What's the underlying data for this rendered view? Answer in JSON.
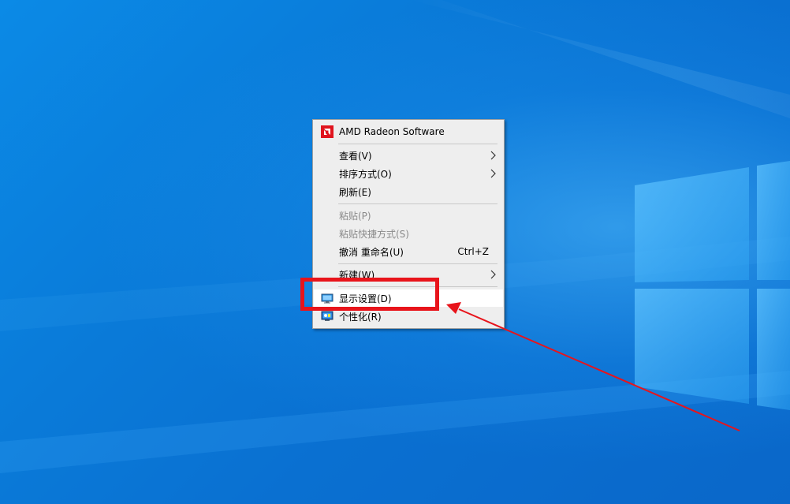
{
  "context_menu": {
    "header": {
      "label": "AMD Radeon Software",
      "icon": "amd-radeon-icon",
      "icon_color": "#e0141e"
    },
    "items": [
      {
        "label": "查看(V)",
        "has_submenu": true
      },
      {
        "label": "排序方式(O)",
        "has_submenu": true
      },
      {
        "label": "刷新(E)"
      },
      {
        "label": "粘贴(P)",
        "disabled": true
      },
      {
        "label": "粘贴快捷方式(S)",
        "disabled": true
      },
      {
        "label": "撤消 重命名(U)",
        "shortcut": "Ctrl+Z"
      },
      {
        "label": "新建(W)",
        "has_submenu": true
      },
      {
        "label": "显示设置(D)",
        "icon": "display-settings-icon",
        "highlighted": true
      },
      {
        "label": "个性化(R)",
        "icon": "personalize-icon"
      }
    ]
  },
  "annotation": {
    "highlight_color": "#e8141b",
    "target": "显示设置(D)"
  },
  "colors": {
    "desktop_blue": "#0a78d7",
    "menu_background": "#eeeeee",
    "disabled_text": "#8a8a8a"
  }
}
